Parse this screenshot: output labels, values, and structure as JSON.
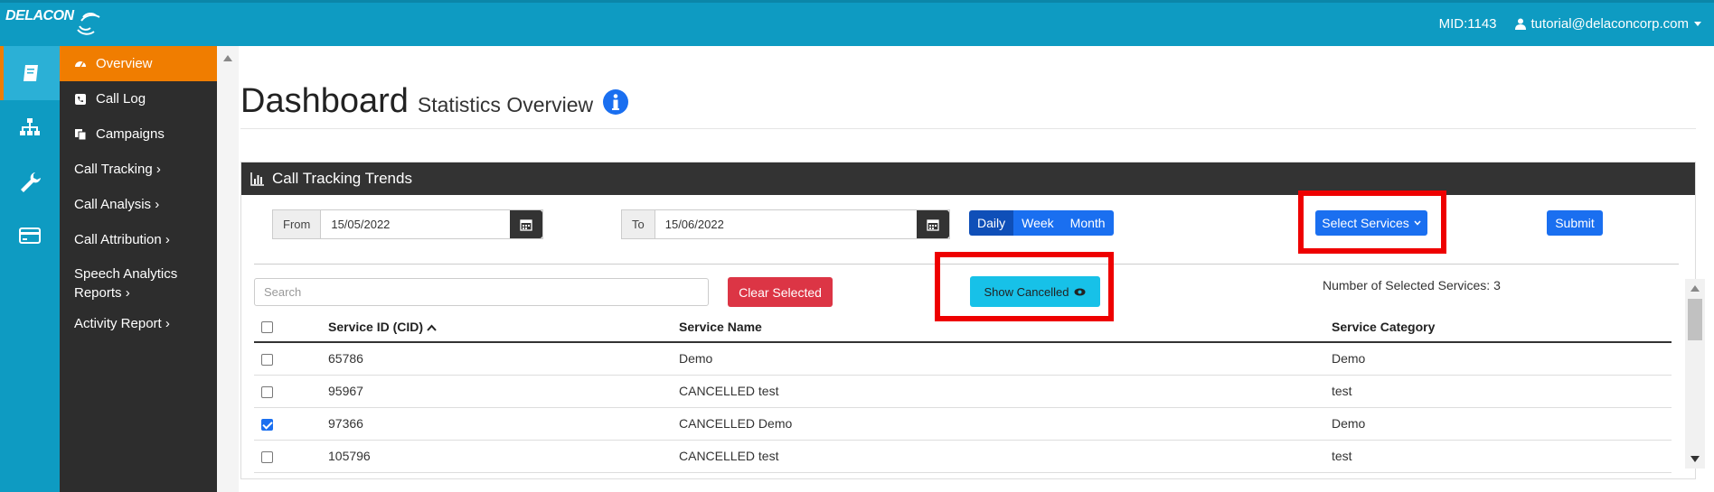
{
  "topbar": {
    "brand": "DELACON",
    "mid": "MID:1143",
    "user_email": "tutorial@delaconcorp.com"
  },
  "sidebar": {
    "items": [
      {
        "label": "Overview"
      },
      {
        "label": "Call Log"
      },
      {
        "label": "Campaigns"
      },
      {
        "label": "Call Tracking ›"
      },
      {
        "label": "Call Analysis ›"
      },
      {
        "label": "Call Attribution ›"
      },
      {
        "label": "Speech Analytics",
        "label2": "Reports ›"
      },
      {
        "label": "Activity Report ›"
      }
    ]
  },
  "header": {
    "title": "Dashboard",
    "subtitle": "Statistics Overview"
  },
  "panel": {
    "title": "Call Tracking Trends",
    "from_label": "From",
    "from_value": "15/05/2022",
    "to_label": "To",
    "to_value": "15/06/2022",
    "period_buttons": [
      "Daily",
      "Week",
      "Month"
    ],
    "select_services": "Select Services",
    "submit": "Submit",
    "search_placeholder": "Search",
    "clear_selected": "Clear Selected",
    "show_cancelled": "Show Cancelled",
    "selected_count": "Number of Selected Services: 3"
  },
  "table": {
    "headers": [
      "Service ID (CID)",
      "Service Name",
      "Service Category"
    ],
    "rows": [
      {
        "id": "65786",
        "name": "Demo",
        "category": "Demo",
        "checked": false
      },
      {
        "id": "95967",
        "name": "CANCELLED test",
        "category": "test",
        "checked": false
      },
      {
        "id": "97366",
        "name": "CANCELLED Demo",
        "category": "Demo",
        "checked": true
      },
      {
        "id": "105796",
        "name": "CANCELLED test",
        "category": "test",
        "checked": false
      }
    ]
  },
  "colors": {
    "brand": "#0e9bc2",
    "accent": "#f07d00",
    "primary": "#1a6ff0",
    "danger": "#dc3545",
    "info": "#17c1e8",
    "highlight": "#ee0000"
  }
}
